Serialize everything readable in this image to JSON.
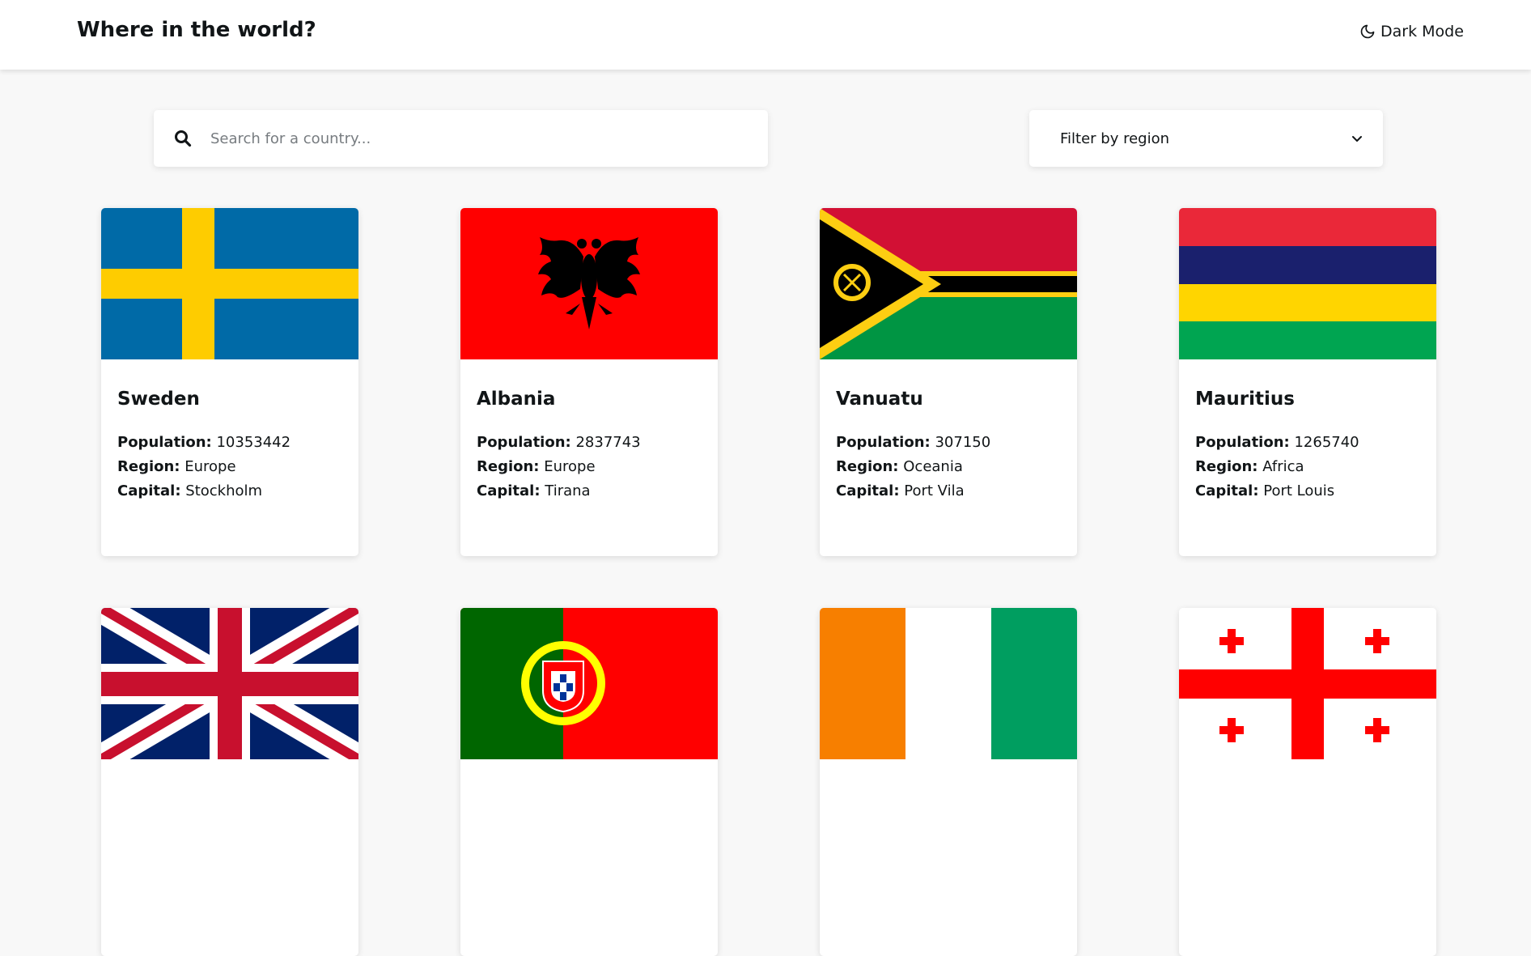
{
  "header": {
    "title": "Where in the world?",
    "mode_label": "Dark Mode"
  },
  "search": {
    "placeholder": "Search for a country..."
  },
  "filter": {
    "label": "Filter by region"
  },
  "labels": {
    "population": "Population:",
    "region": "Region:",
    "capital": "Capital:"
  },
  "countries": [
    {
      "name": "Sweden",
      "population": "10353442",
      "region": "Europe",
      "capital": "Stockholm"
    },
    {
      "name": "Albania",
      "population": "2837743",
      "region": "Europe",
      "capital": "Tirana"
    },
    {
      "name": "Vanuatu",
      "population": "307150",
      "region": "Oceania",
      "capital": "Port Vila"
    },
    {
      "name": "Mauritius",
      "population": "1265740",
      "region": "Africa",
      "capital": "Port Louis"
    }
  ],
  "colors": {
    "background": "#f8f8f8",
    "card": "#ffffff",
    "text": "#111517"
  },
  "icons": [
    "moon-icon",
    "search-icon",
    "chevron-down-icon"
  ]
}
